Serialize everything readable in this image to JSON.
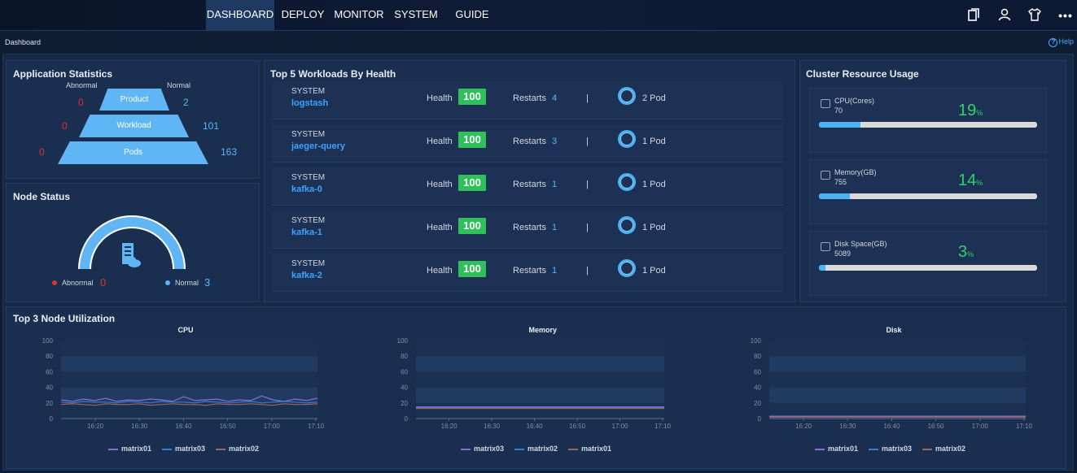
{
  "nav": {
    "items": [
      {
        "label": "DASHBOARD",
        "active": true
      },
      {
        "label": "DEPLOY"
      },
      {
        "label": "MONITOR"
      },
      {
        "label": "SYSTEM"
      },
      {
        "label": "GUIDE"
      }
    ],
    "icons": [
      "document-icon",
      "user-icon",
      "shirt-icon",
      "more-icon"
    ]
  },
  "breadcrumb": "Dashboard",
  "help_label": "Help",
  "app_stats": {
    "title": "Application Statistics",
    "abnormal_label": "Abnormal",
    "normal_label": "Normal",
    "rows": [
      {
        "label": "Product",
        "abnormal": "0",
        "normal": "2"
      },
      {
        "label": "Workload",
        "abnormal": "0",
        "normal": "101"
      },
      {
        "label": "Pods",
        "abnormal": "0",
        "normal": "163"
      }
    ]
  },
  "node_status": {
    "title": "Node Status",
    "abnormal_label": "Abnormal",
    "abnormal_value": "0",
    "normal_label": "Normal",
    "normal_value": "3"
  },
  "workloads": {
    "title": "Top 5 Workloads By Health",
    "health_label": "Health",
    "restarts_label": "Restarts",
    "separator": "|",
    "rows": [
      {
        "namespace": "SYSTEM",
        "name": "logstash",
        "health": "100",
        "restarts": "4",
        "pods": "2 Pod"
      },
      {
        "namespace": "SYSTEM",
        "name": "jaeger-query",
        "health": "100",
        "restarts": "3",
        "pods": "1 Pod"
      },
      {
        "namespace": "SYSTEM",
        "name": "kafka-0",
        "health": "100",
        "restarts": "1",
        "pods": "1 Pod"
      },
      {
        "namespace": "SYSTEM",
        "name": "kafka-1",
        "health": "100",
        "restarts": "1",
        "pods": "1 Pod"
      },
      {
        "namespace": "SYSTEM",
        "name": "kafka-2",
        "health": "100",
        "restarts": "1",
        "pods": "1 Pod"
      }
    ]
  },
  "cluster": {
    "title": "Cluster Resource Usage",
    "pct_unit": "%",
    "items": [
      {
        "label": "CPU(Cores)",
        "value": "70",
        "pct": 19,
        "icon": "cpu-icon"
      },
      {
        "label": "Memory(GB)",
        "value": "755",
        "pct": 14,
        "icon": "memory-icon"
      },
      {
        "label": "Disk Space(GB)",
        "value": "5089",
        "pct": 3,
        "icon": "disk-icon"
      }
    ]
  },
  "node_util": {
    "title": "Top 3 Node Utilization"
  },
  "colors": {
    "accent": "#4bb2f5",
    "health_green": "#2fc05b",
    "error_red": "#e0302f",
    "series_purple": "#8a6fd1",
    "series_blue": "#3a7bd5",
    "series_brown": "#a0675a"
  },
  "chart_data": [
    {
      "type": "line",
      "title": "CPU",
      "ylim": [
        0,
        100
      ],
      "yticks": [
        "0",
        "20",
        "40",
        "60",
        "80",
        "100"
      ],
      "x": [
        "16:20",
        "16:30",
        "16:40",
        "16:50",
        "17:00",
        "17:10"
      ],
      "series": [
        {
          "name": "matrix01",
          "color": "#8a6fd1",
          "values": [
            24,
            22,
            25,
            23,
            26,
            22,
            24,
            23,
            25,
            24,
            22,
            28,
            23,
            24,
            25,
            22,
            24,
            23,
            29,
            24,
            22,
            25,
            23,
            26
          ]
        },
        {
          "name": "matrix03",
          "color": "#3a7bd5",
          "values": [
            21,
            20,
            22,
            21,
            21,
            20,
            22,
            21,
            20,
            22,
            21,
            21,
            20,
            22,
            21,
            20,
            21,
            22,
            20,
            21,
            22,
            21,
            20,
            21
          ]
        },
        {
          "name": "matrix02",
          "color": "#a0675a",
          "values": [
            18,
            19,
            18,
            17,
            19,
            18,
            18,
            19,
            17,
            18,
            19,
            18,
            18,
            17,
            19,
            18,
            18,
            19,
            18,
            17,
            19,
            18,
            18,
            19
          ]
        }
      ]
    },
    {
      "type": "line",
      "title": "Memory",
      "ylim": [
        0,
        100
      ],
      "yticks": [
        "0",
        "20",
        "40",
        "60",
        "80",
        "100"
      ],
      "x": [
        "16:20",
        "16:30",
        "16:40",
        "16:50",
        "17:00",
        "17:10"
      ],
      "series": [
        {
          "name": "matrix03",
          "color": "#8a6fd1",
          "values": [
            15,
            15,
            15,
            15,
            15,
            15,
            15,
            15,
            15,
            15,
            15,
            15
          ]
        },
        {
          "name": "matrix02",
          "color": "#3a7bd5",
          "values": [
            14,
            14,
            14,
            14,
            14,
            14,
            14,
            14,
            14,
            14,
            14,
            14
          ]
        },
        {
          "name": "matrix01",
          "color": "#a0675a",
          "values": [
            13,
            13,
            13,
            13,
            13,
            13,
            13,
            13,
            13,
            13,
            13,
            13
          ]
        }
      ]
    },
    {
      "type": "line",
      "title": "Disk",
      "ylim": [
        0,
        100
      ],
      "yticks": [
        "0",
        "20",
        "40",
        "60",
        "80",
        "100"
      ],
      "x": [
        "16:20",
        "16:30",
        "16:40",
        "16:50",
        "17:00",
        "17:10"
      ],
      "series": [
        {
          "name": "matrix01",
          "color": "#8a6fd1",
          "values": [
            3,
            3,
            3,
            3,
            3,
            3,
            3,
            3,
            3,
            3,
            3,
            3
          ]
        },
        {
          "name": "matrix03",
          "color": "#3a7bd5",
          "values": [
            2,
            2,
            2,
            2,
            2,
            2,
            2,
            2,
            2,
            2,
            2,
            2
          ]
        },
        {
          "name": "matrix02",
          "color": "#a0675a",
          "values": [
            2,
            2,
            2,
            2,
            2,
            2,
            2,
            2,
            2,
            2,
            2,
            2
          ]
        }
      ]
    }
  ]
}
